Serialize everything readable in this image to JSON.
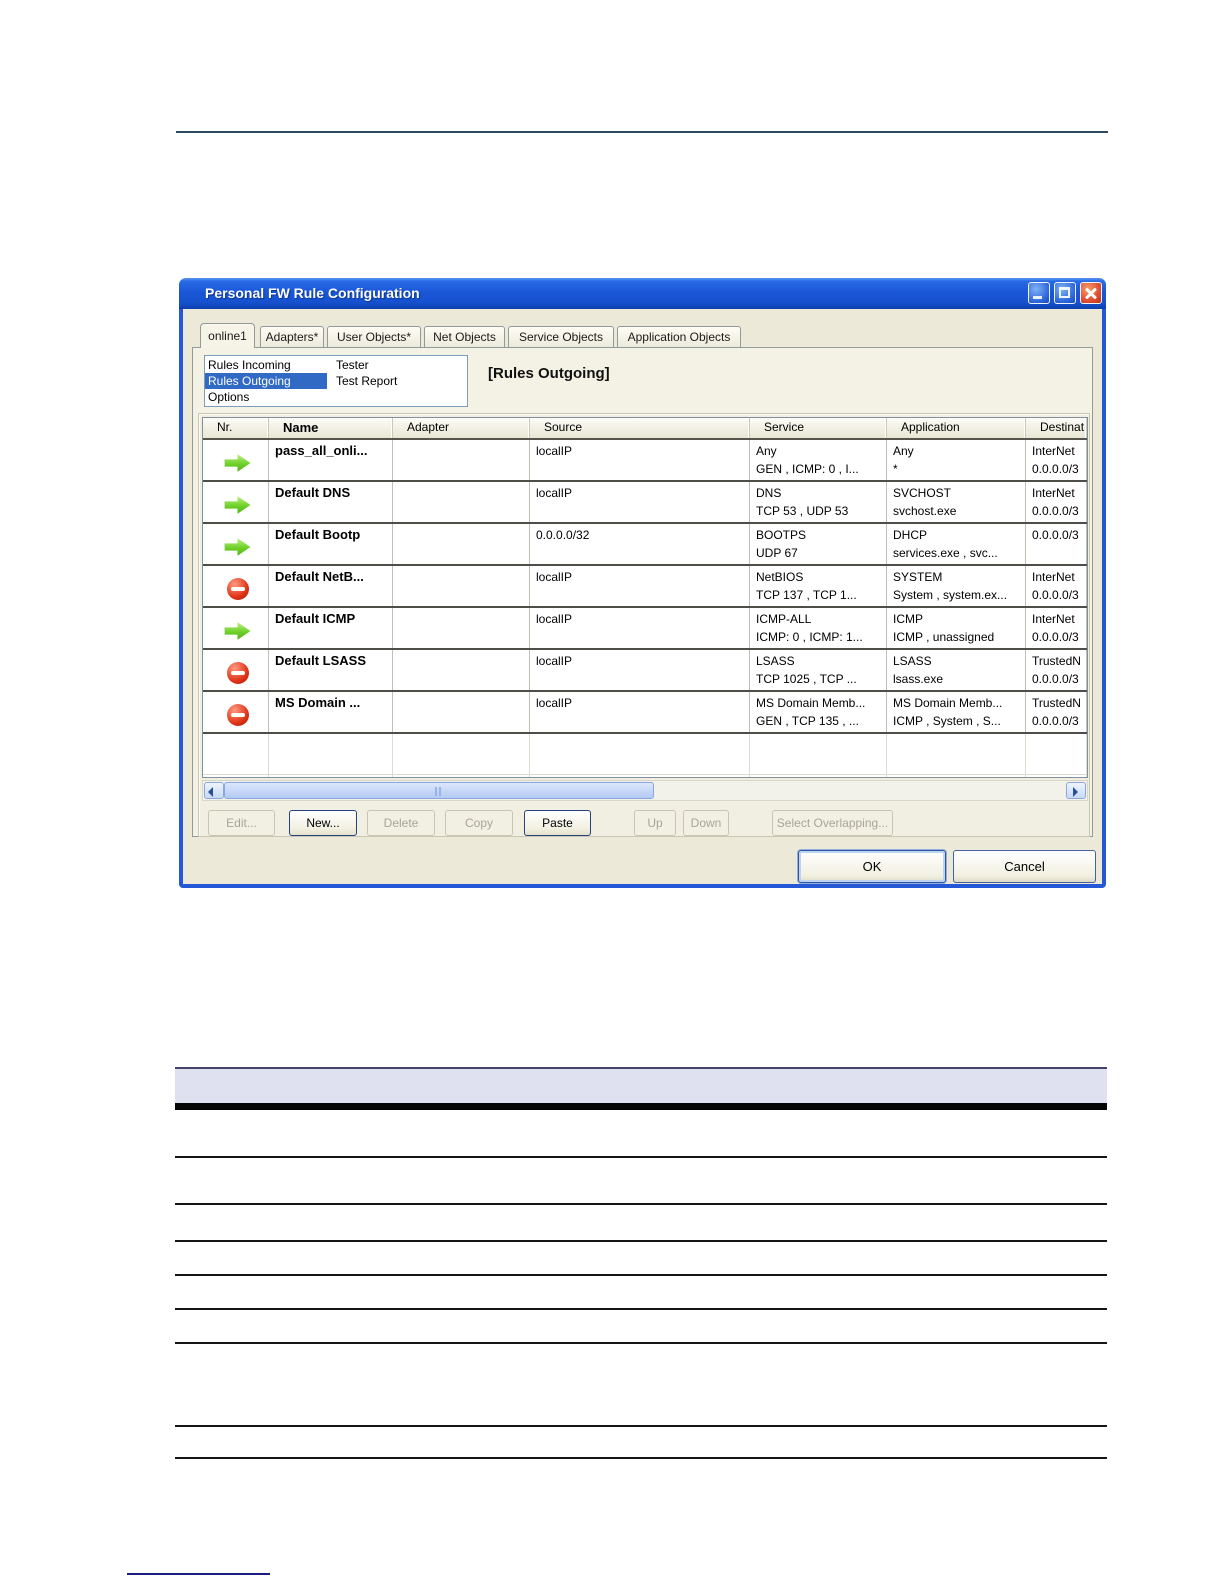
{
  "window": {
    "title": "Personal FW Rule Configuration"
  },
  "tabs": [
    {
      "label": "online1",
      "active": true
    },
    {
      "label": "Adapters*",
      "active": false
    },
    {
      "label": "User Objects*",
      "active": false
    },
    {
      "label": "Net Objects",
      "active": false
    },
    {
      "label": "Service Objects",
      "active": false
    },
    {
      "label": "Application Objects",
      "active": false
    }
  ],
  "nav": {
    "items_left": [
      "Rules Incoming",
      "Rules Outgoing",
      "Options"
    ],
    "items_right": [
      "Tester",
      "Test Report"
    ],
    "selected": "Rules Outgoing"
  },
  "section_title": "[Rules Outgoing]",
  "grid": {
    "columns": [
      "Nr.",
      "Name",
      "Adapter",
      "Source",
      "Service",
      "Application",
      "Destinat"
    ],
    "rows": [
      {
        "icon": "allow",
        "name": "pass_all_onli...",
        "adapter": "",
        "source": "localIP",
        "service_line1": "Any",
        "service_line2": "GEN , ICMP: 0 , I...",
        "app_line1": "Any",
        "app_line2": "*",
        "dest_line1": "InterNet",
        "dest_line2": "0.0.0.0/3"
      },
      {
        "icon": "allow",
        "name": "Default DNS",
        "adapter": "",
        "source": "localIP",
        "service_line1": "DNS",
        "service_line2": "TCP 53 , UDP 53",
        "app_line1": "SVCHOST",
        "app_line2": "svchost.exe",
        "dest_line1": "InterNet",
        "dest_line2": "0.0.0.0/3"
      },
      {
        "icon": "allow",
        "name": "Default Bootp",
        "adapter": "",
        "source": "0.0.0.0/32",
        "service_line1": "BOOTPS",
        "service_line2": "UDP 67",
        "app_line1": "DHCP",
        "app_line2": "services.exe , svc...",
        "dest_line1": "0.0.0.0/3",
        "dest_line2": ""
      },
      {
        "icon": "deny",
        "name": "Default NetB...",
        "adapter": "",
        "source": "localIP",
        "service_line1": "NetBIOS",
        "service_line2": "TCP 137 , TCP 1...",
        "app_line1": "SYSTEM",
        "app_line2": "System , system.ex...",
        "dest_line1": "InterNet",
        "dest_line2": "0.0.0.0/3"
      },
      {
        "icon": "allow",
        "name": "Default ICMP",
        "adapter": "",
        "source": "localIP",
        "service_line1": "ICMP-ALL",
        "service_line2": "ICMP: 0 , ICMP: 1...",
        "app_line1": "ICMP",
        "app_line2": "ICMP , unassigned",
        "dest_line1": "InterNet",
        "dest_line2": "0.0.0.0/3"
      },
      {
        "icon": "deny",
        "name": "Default LSASS",
        "adapter": "",
        "source": "localIP",
        "service_line1": "LSASS",
        "service_line2": "TCP 1025 , TCP ...",
        "app_line1": "LSASS",
        "app_line2": "lsass.exe",
        "dest_line1": "TrustedN",
        "dest_line2": "0.0.0.0/3"
      },
      {
        "icon": "deny",
        "name": "MS Domain ...",
        "adapter": "",
        "source": "localIP",
        "service_line1": "MS Domain Memb...",
        "service_line2": "GEN , TCP 135 , ...",
        "app_line1": "MS Domain Memb...",
        "app_line2": "ICMP , System , S...",
        "dest_line1": "TrustedN",
        "dest_line2": "0.0.0.0/3"
      }
    ]
  },
  "toolbar": {
    "buttons": [
      {
        "label": "Edit...",
        "enabled": false
      },
      {
        "label": "New...",
        "enabled": true
      },
      {
        "label": "Delete",
        "enabled": false
      },
      {
        "label": "Copy",
        "enabled": false
      },
      {
        "label": "Paste",
        "enabled": true
      },
      {
        "label": "Up",
        "enabled": false
      },
      {
        "label": "Down",
        "enabled": false
      },
      {
        "label": "Select Overlapping...",
        "enabled": false
      }
    ]
  },
  "dialog_actions": {
    "ok": "OK",
    "cancel": "Cancel"
  },
  "colors": {
    "titlebar_blue": "#1a57d8",
    "dialog_face": "#ece9d8",
    "selection_blue": "#316ac5",
    "allow_green": "#6fd028",
    "deny_red": "#e03418",
    "doc_header_band": "#dfe1f1",
    "top_rule_navy": "#2d4a63",
    "footer_link_blue": "#1b1b8a"
  }
}
